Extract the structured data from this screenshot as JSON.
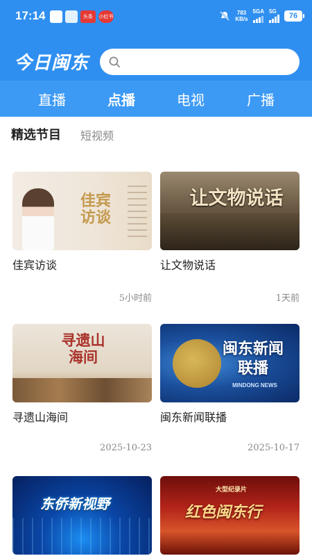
{
  "status": {
    "time": "17:14",
    "apps": [
      "人民日报",
      "微博",
      "头条",
      "小红书"
    ],
    "net_speed_top": "783",
    "net_speed_bottom": "KB/s",
    "sig1": "5GA",
    "sig2": "5G",
    "battery": "76"
  },
  "header": {
    "brand": "今日闽东",
    "search_placeholder": ""
  },
  "tabs": [
    {
      "label": "直播",
      "active": false
    },
    {
      "label": "点播",
      "active": true
    },
    {
      "label": "电视",
      "active": false
    },
    {
      "label": "广播",
      "active": false
    }
  ],
  "subtabs": {
    "selected": "精选节目",
    "other": "短视频"
  },
  "cards": [
    {
      "title": "佳宾访谈",
      "time": "5小时前",
      "thumb_text": "佳宾访谈"
    },
    {
      "title": "让文物说话",
      "time": "1天前",
      "thumb_text": "让文物说话"
    },
    {
      "title": "寻遗山海间",
      "time": "2025-10-23",
      "thumb_text": "寻遗山海间"
    },
    {
      "title": "闽东新闻联播",
      "time": "2025-10-17",
      "thumb_text": "闽东新闻联播",
      "thumb_sub": "MINDONG NEWS"
    },
    {
      "title": "",
      "time": "",
      "thumb_text": "东侨新视野"
    },
    {
      "title": "",
      "time": "",
      "thumb_text": "红色闽东行",
      "thumb_sub": "大型纪录片"
    }
  ],
  "colors": {
    "brand_blue": "#2f8ff0",
    "tab_blue": "#3d9af4"
  }
}
